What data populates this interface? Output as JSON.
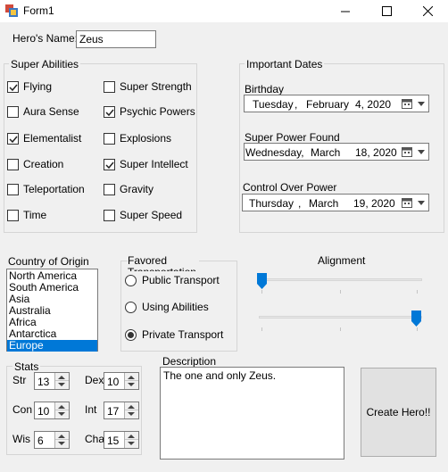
{
  "window": {
    "title": "Form1"
  },
  "hero": {
    "name_label": "Hero's Name:",
    "name_value": "Zeus"
  },
  "abilities": {
    "group_label": "Super Abilities",
    "left": [
      {
        "label": "Flying",
        "checked": true
      },
      {
        "label": "Aura Sense",
        "checked": false
      },
      {
        "label": "Elementalist",
        "checked": true
      },
      {
        "label": "Creation",
        "checked": false
      },
      {
        "label": "Teleportation",
        "checked": false
      },
      {
        "label": "Time",
        "checked": false
      }
    ],
    "right": [
      {
        "label": "Super Strength",
        "checked": false
      },
      {
        "label": "Psychic Powers",
        "checked": true
      },
      {
        "label": "Explosions",
        "checked": false
      },
      {
        "label": "Super Intellect",
        "checked": true
      },
      {
        "label": "Gravity",
        "checked": false
      },
      {
        "label": "Super Speed",
        "checked": false
      }
    ]
  },
  "dates": {
    "group_label": "Important Dates",
    "birthday": {
      "label": "Birthday",
      "weekday": "Tuesday",
      "month": "February",
      "day": "4, 2020"
    },
    "found": {
      "label": "Super Power Found",
      "weekday": "Wednesday,",
      "month": "March",
      "day": "18, 2020"
    },
    "control": {
      "label": "Control Over Power",
      "weekday": "Thursday",
      "month": "March",
      "day": "19, 2020"
    }
  },
  "country": {
    "label": "Country of Origin",
    "options": [
      "North America",
      "South America",
      "Asia",
      "Australia",
      "Africa",
      "Antarctica",
      "Europe"
    ],
    "selected": "Europe"
  },
  "transport": {
    "group_label": "Favored Transportation",
    "options": [
      {
        "label": "Public Transport",
        "checked": false
      },
      {
        "label": "Using Abilities",
        "checked": false
      },
      {
        "label": "Private Transport",
        "checked": true
      }
    ]
  },
  "alignment": {
    "label": "Alignment"
  },
  "stats": {
    "group_label": "Stats",
    "str": {
      "label": "Str",
      "value": "13"
    },
    "dex": {
      "label": "Dex",
      "value": "10"
    },
    "con": {
      "label": "Con",
      "value": "10"
    },
    "int": {
      "label": "Int",
      "value": "17"
    },
    "wis": {
      "label": "Wis",
      "value": "6"
    },
    "cha": {
      "label": "Cha",
      "value": "15"
    }
  },
  "description": {
    "label": "Description",
    "value": "The one and only Zeus."
  },
  "create_button": {
    "label": "Create Hero!!"
  },
  "colors": {
    "accent": "#0078d7"
  }
}
